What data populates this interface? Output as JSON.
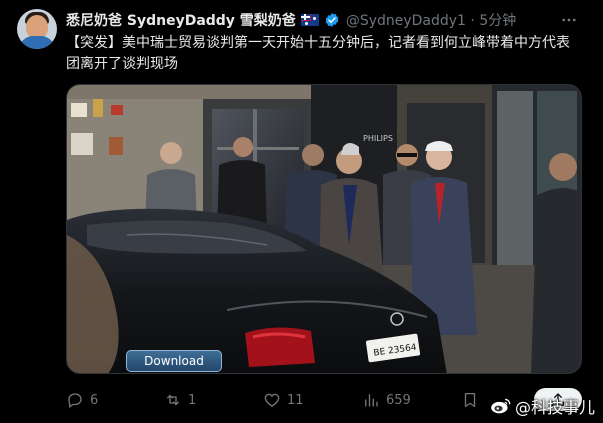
{
  "post": {
    "display_name": "悉尼奶爸 SydneyDaddy 雪梨奶爸",
    "flag_icon": "australia-flag-icon",
    "verified_icon": "verified-badge-icon",
    "handle_time": "@SydneyDaddy1 · 5分钟",
    "text": "【突发】美中瑞士贸易谈判第一天开始十五分钟后，记者看到何立峰带着中方代表团离开了谈判现场",
    "media": {
      "download_label": "Download",
      "license_plate": "BE 23564",
      "building_sign": "PHILIPS"
    }
  },
  "actions": {
    "reply_count": "6",
    "repost_count": "1",
    "like_count": "11",
    "views_count": "659"
  },
  "watermark": {
    "text": "@科技事儿"
  },
  "colors": {
    "background": "#000000",
    "text": "#e7e9ea",
    "muted": "#71767b",
    "verified": "#1d9bf0"
  }
}
